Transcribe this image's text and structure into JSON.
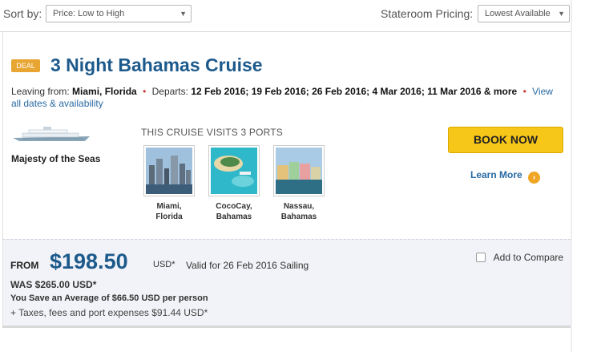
{
  "sort": {
    "label": "Sort by:",
    "selected": "Price: Low to High",
    "pricing_label": "Stateroom Pricing:",
    "pricing_selected": "Lowest Available"
  },
  "cruise": {
    "badge": "DEAL",
    "title": "3 Night Bahamas Cruise",
    "leaving_label": "Leaving from:",
    "leaving_value": "Miami, Florida",
    "departs_label": "Departs:",
    "departs_value": "12 Feb 2016; 19 Feb 2016; 26 Feb 2016; 4 Mar 2016; 11 Mar 2016 & more",
    "view_link": "View all dates & availability",
    "ship_name": "Majesty of the Seas",
    "ports_heading": "THIS CRUISE VISITS 3 PORTS",
    "ports": [
      {
        "line1": "Miami,",
        "line2": "Florida"
      },
      {
        "line1": "CocoCay,",
        "line2": "Bahamas"
      },
      {
        "line1": "Nassau,",
        "line2": "Bahamas"
      }
    ],
    "book_label": "BOOK NOW",
    "learn_more": "Learn More"
  },
  "price": {
    "from_label": "FROM",
    "amount": "$198.50",
    "currency": "USD*",
    "valid": "Valid for 26 Feb 2016 Sailing",
    "compare_label": "Add to Compare",
    "was": "WAS $265.00 USD*",
    "save": "You Save an Average of $66.50 USD  per person",
    "taxes": "+ Taxes, fees and port expenses $91.44 USD*"
  },
  "colors": {
    "accent_blue": "#1d5a8c",
    "book_yellow": "#f6c619",
    "deal_orange": "#e8a531"
  }
}
